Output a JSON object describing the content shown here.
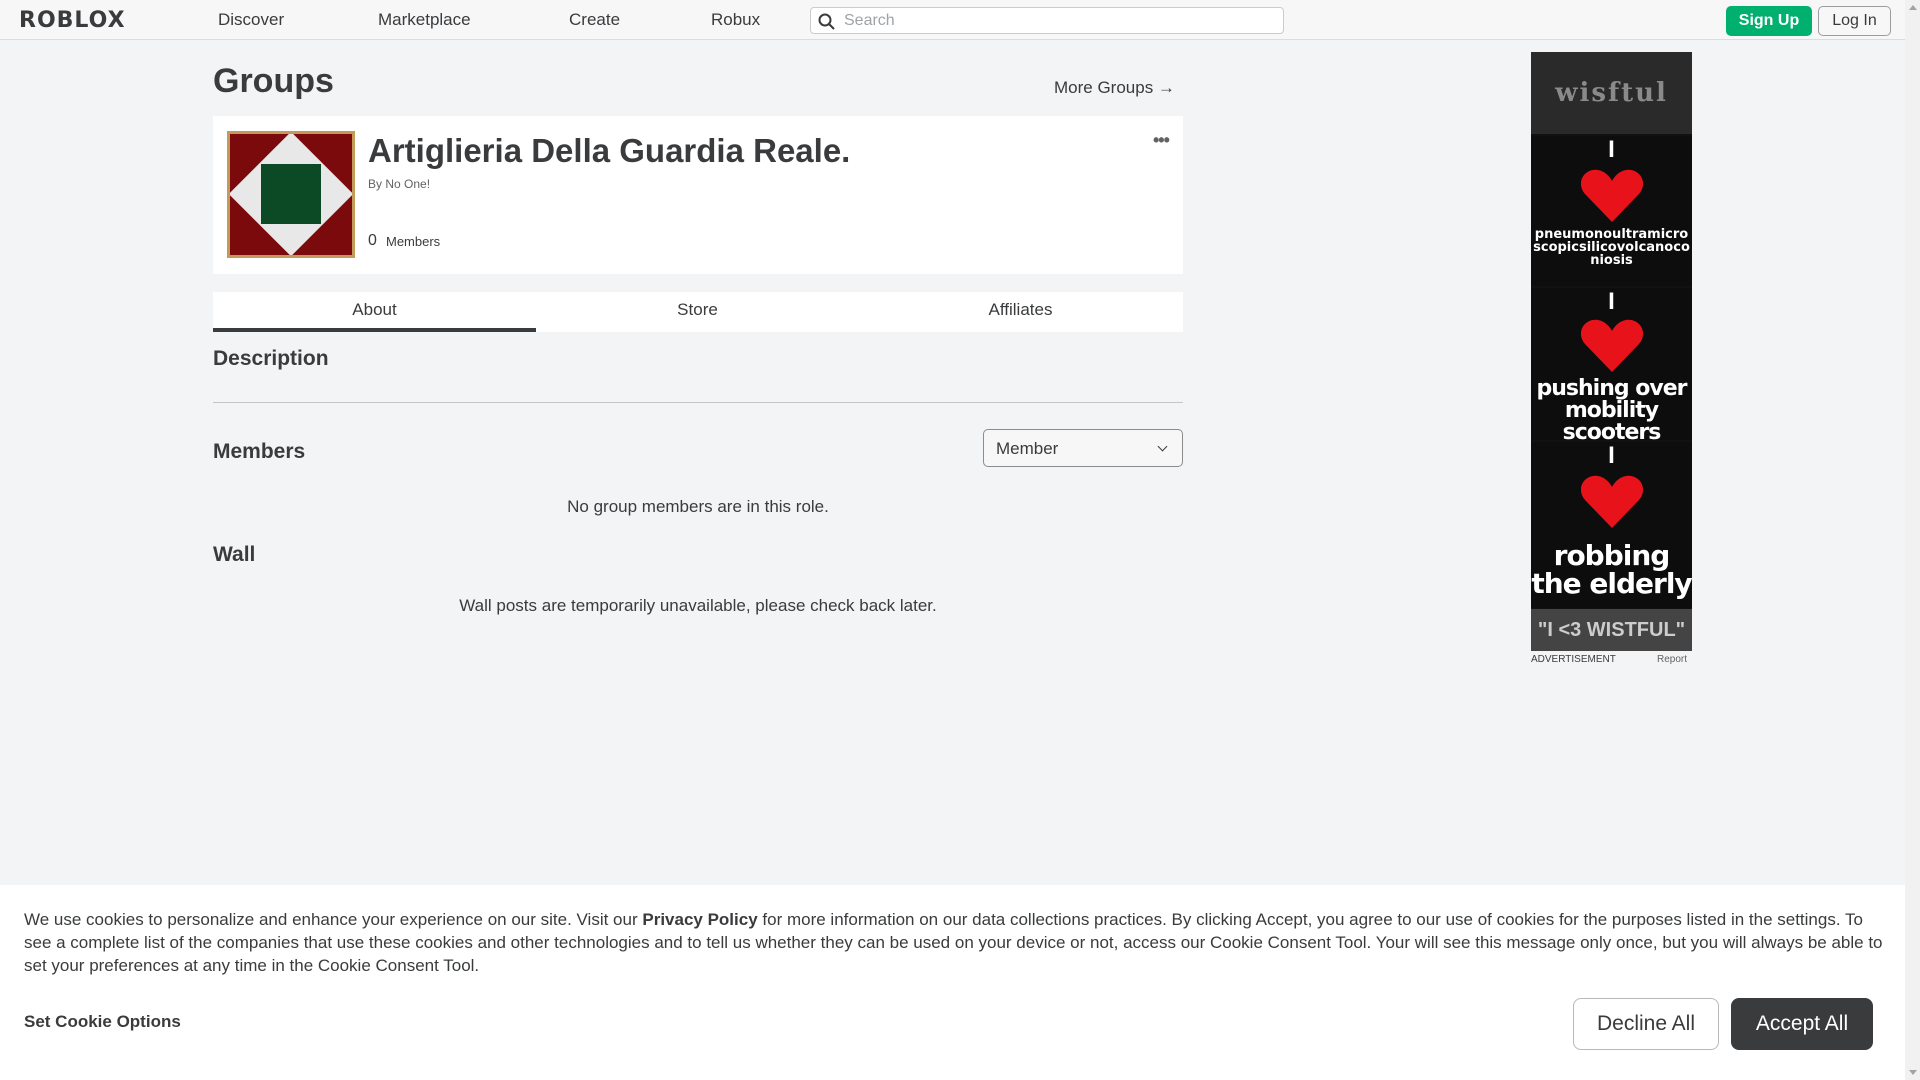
{
  "header": {
    "logo": "ROBLOX",
    "nav": [
      "Discover",
      "Marketplace",
      "Create",
      "Robux"
    ],
    "search_placeholder": "Search",
    "signup_label": "Sign Up",
    "login_label": "Log In"
  },
  "page": {
    "title": "Groups",
    "more_groups": "More Groups →"
  },
  "group": {
    "name": "Artiglieria Della Guardia Reale.",
    "owner_line": "By No One!",
    "member_count": "0",
    "member_label": "Members",
    "menu_icon": "•••"
  },
  "tabs": [
    "About",
    "Store",
    "Affiliates"
  ],
  "sections": {
    "description": "Description",
    "members": "Members",
    "role_selected": "Member",
    "members_empty": "No group members are in this role.",
    "wall": "Wall",
    "wall_note": "Wall posts are temporarily unavailable, please check back later."
  },
  "ad": {
    "top": "wisftul",
    "i1": "I",
    "text1": "pneumonoultramicroscopicsilicovolcanoconiosis",
    "i2": "I",
    "text2": "pushing over mobility scooters",
    "i3": "I",
    "text3": "robbing the elderly",
    "footer": "\"I <3 WISTFUL\"",
    "label": "ADVERTISEMENT",
    "report": "Report"
  },
  "cookie": {
    "text_before": "We use cookies to personalize and enhance your experience on our site. Visit our ",
    "privacy_link": "Privacy Policy",
    "text_after": " for more information on our data collections practices. By clicking Accept, you agree to our use of cookies for the purposes listed in the settings. To see a complete list of the companies that use these cookies and other technologies and to tell us whether they can be used on your device or not, access our Cookie Consent Tool. Your will see this message only once, but you will always be able to set your preferences at any time in the Cookie Consent Tool.",
    "options_label": "Set Cookie Options",
    "decline_label": "Decline All",
    "accept_label": "Accept All"
  },
  "colors": {
    "accent_green": "#00b06f",
    "text_dark": "#393b3d",
    "emblem_red": "#7a0a0c",
    "emblem_green": "#0c4a25"
  }
}
